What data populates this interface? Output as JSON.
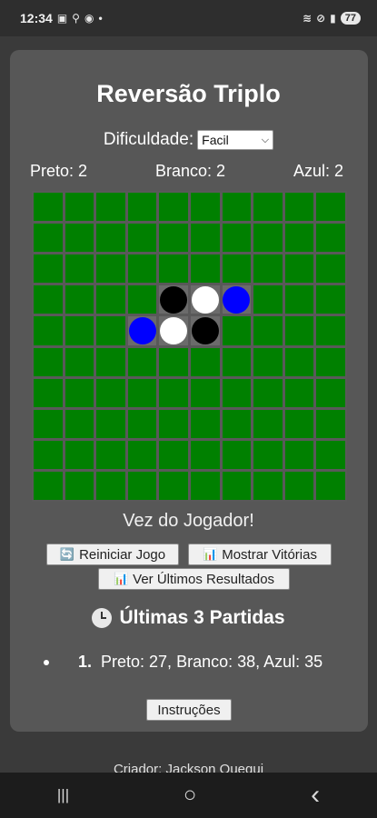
{
  "status_bar": {
    "time": "12:34",
    "icons_left": [
      "notification-icon",
      "link-icon",
      "circle-icon"
    ],
    "dot": "•",
    "icons_right": [
      "wifi-icon",
      "dnd-icon",
      "signal-icon"
    ],
    "battery": "77"
  },
  "game": {
    "title": "Reversão Triplo",
    "difficulty_label": "Dificuldade:",
    "difficulty_value": "Facil",
    "scores": {
      "black": "Preto: 2",
      "white": "Branco: 2",
      "blue": "Azul: 2"
    },
    "board": {
      "size": 10,
      "pieces": [
        {
          "row": 3,
          "col": 4,
          "color": "black"
        },
        {
          "row": 3,
          "col": 5,
          "color": "white"
        },
        {
          "row": 3,
          "col": 6,
          "color": "blue"
        },
        {
          "row": 4,
          "col": 3,
          "color": "blue"
        },
        {
          "row": 4,
          "col": 4,
          "color": "white"
        },
        {
          "row": 4,
          "col": 5,
          "color": "black"
        }
      ],
      "highlighted": [
        {
          "row": 3,
          "col": 4
        },
        {
          "row": 3,
          "col": 5
        },
        {
          "row": 3,
          "col": 6
        },
        {
          "row": 4,
          "col": 3
        },
        {
          "row": 4,
          "col": 4
        },
        {
          "row": 4,
          "col": 5
        }
      ],
      "colors": {
        "cell": "#008000",
        "black": "#000000",
        "white": "#ffffff",
        "blue": "#0000ff"
      }
    },
    "turn_text": "Vez do Jogador!",
    "buttons": {
      "restart": "Reiniciar Jogo",
      "show_wins": "Mostrar Vitórias",
      "last_results": "Ver Últimos Resultados",
      "instructions": "Instruções"
    },
    "history": {
      "title": "Últimas 3 Partidas",
      "items": [
        {
          "rank": "1.",
          "text": "Preto: 27, Branco: 38, Azul: 35"
        }
      ]
    },
    "creator": "Criador: Jackson Quequi"
  },
  "nav": {
    "recent": "|||",
    "home": "○",
    "back": "‹"
  }
}
